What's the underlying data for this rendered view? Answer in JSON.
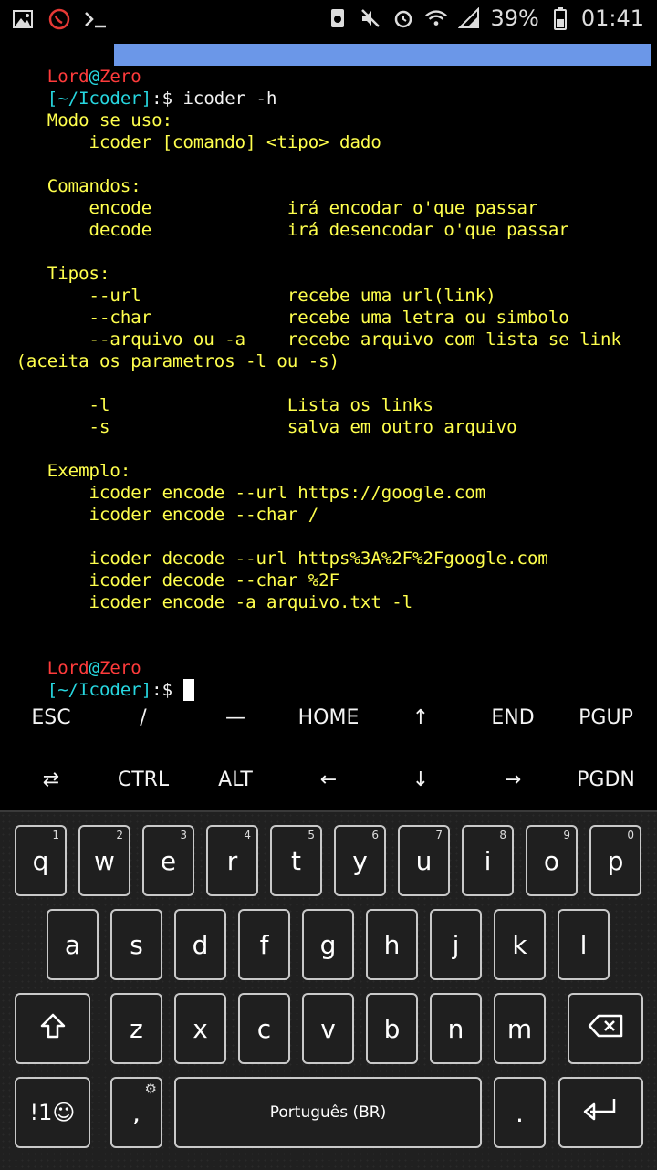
{
  "status_bar": {
    "battery": "39%",
    "time": "01:41"
  },
  "terminal": {
    "prompt_user": "Lord",
    "prompt_at": "@",
    "prompt_host": "Zero",
    "prompt_path": "[~/Icoder]",
    "prompt_symbol": ":$",
    "command": " icoder -h",
    "output": [
      "    Modo se uso:",
      "        icoder [comando] <tipo> dado",
      "",
      "    Comandos:",
      "        encode             irá encodar o'que passar",
      "        decode             irá desencodar o'que passar",
      "",
      "    Tipos:",
      "        --url              recebe uma url(link)",
      "        --char             recebe uma letra ou simbolo",
      "        --arquivo ou -a    recebe arquivo com lista se link",
      " (aceita os parametros -l ou -s)",
      "",
      "        -l                 Lista os links",
      "        -s                 salva em outro arquivo",
      "",
      "    Exemplo:",
      "        icoder encode --url https://google.com",
      "        icoder encode --char /",
      "",
      "        icoder decode --url https%3A%2F%2Fgoogle.com",
      "        icoder decode --char %2F",
      "        icoder encode -a arquivo.txt -l"
    ]
  },
  "extra_keys": {
    "row1": [
      "ESC",
      "/",
      "—",
      "HOME",
      "↑",
      "END",
      "PGUP"
    ],
    "row2": [
      "⇄",
      "CTRL",
      "ALT",
      "←",
      "↓",
      "→",
      "PGDN"
    ]
  },
  "keyboard": {
    "row1": [
      {
        "key": "q",
        "hint": "1"
      },
      {
        "key": "w",
        "hint": "2"
      },
      {
        "key": "e",
        "hint": "3"
      },
      {
        "key": "r",
        "hint": "4"
      },
      {
        "key": "t",
        "hint": "5"
      },
      {
        "key": "y",
        "hint": "6"
      },
      {
        "key": "u",
        "hint": "7"
      },
      {
        "key": "i",
        "hint": "8"
      },
      {
        "key": "o",
        "hint": "9"
      },
      {
        "key": "p",
        "hint": "0"
      }
    ],
    "row2": [
      "a",
      "s",
      "d",
      "f",
      "g",
      "h",
      "j",
      "k",
      "l"
    ],
    "row3": [
      "z",
      "x",
      "c",
      "v",
      "b",
      "n",
      "m"
    ],
    "symbols_label": "!1☺",
    "comma": ",",
    "period": ".",
    "space_label": "Português (BR)"
  },
  "colors": {
    "prompt_user": "#ff3b3b",
    "prompt_host": "#ff3b3b",
    "prompt_at": "#27d7e0",
    "output_text": "#ffff4d",
    "title_bar": "#6b97e8"
  }
}
